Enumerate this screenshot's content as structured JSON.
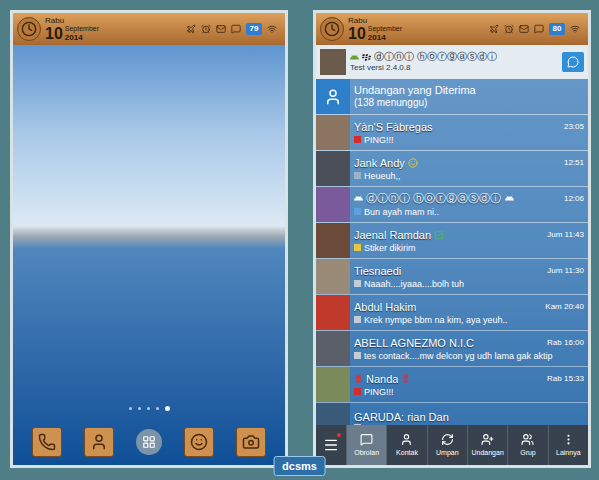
{
  "home_screen": {
    "status_bar": {
      "day": "Rabu",
      "date": "10",
      "month": "September",
      "year": "2014",
      "battery": "79"
    },
    "page_dots": [
      {
        "selected": false
      },
      {
        "selected": false
      },
      {
        "selected": false
      },
      {
        "selected": false
      },
      {
        "selected": true
      }
    ]
  },
  "bbm_screen": {
    "status_bar": {
      "day": "Rabu",
      "date": "10",
      "month": "September",
      "year": "2014",
      "battery": "80"
    },
    "profile": {
      "name": "ⓓⓘⓝⓘ ⓗⓞⓡⓖⓐⓢⓓⓘ",
      "status": "Test versi 2.4.0.8"
    },
    "chats": [
      {
        "kind": "invite",
        "name": "Undangan yang Diterima",
        "message": "(138 menunggu)"
      },
      {
        "kind": "chat",
        "name": "Yàn'S Fàbregas",
        "time": "23:05",
        "message": "PING!!!",
        "marker_color": "#d62b2b",
        "avatar_color": "#8c7560",
        "decorated": false,
        "smiley": false,
        "verified": false,
        "roses": false
      },
      {
        "kind": "chat",
        "name": "Jank Andy",
        "time": "12:51",
        "message": "Heueuh,,",
        "marker_color": "#9bb4c9",
        "avatar_color": "#4a4f5a",
        "decorated": false,
        "smiley": true,
        "verified": false,
        "roses": false
      },
      {
        "kind": "chat",
        "name": "ⓓⓘⓝⓘ ⓗⓞⓡⓖⓐⓢⓓⓘ",
        "time": "12:06",
        "message": "Bun ayah mam ni..",
        "marker_color": "#5e9fe0",
        "avatar_color": "#7a5a9a",
        "decorated": true,
        "smiley": false,
        "verified": false,
        "roses": false
      },
      {
        "kind": "chat",
        "name": "Jaenal Ramdan",
        "time": "Jum 11:43",
        "message": "Stiker dikirim",
        "marker_color": "#e8c640",
        "avatar_color": "#6b4a3a",
        "decorated": false,
        "smiley": false,
        "verified": true,
        "roses": false
      },
      {
        "kind": "chat",
        "name": "Tiesnaedi",
        "time": "Jum 11:30",
        "message": "Naaah....iyaaa....bolh tuh",
        "marker_color": "#c3ccd4",
        "avatar_color": "#9a8a78",
        "decorated": false,
        "smiley": false,
        "verified": false,
        "roses": false
      },
      {
        "kind": "chat",
        "name": "Abdul Hakim",
        "time": "Kam 20:40",
        "message": "Krek nympe bbm na kim, aya yeuh..",
        "marker_color": "#c3ccd4",
        "avatar_color": "#c0392b",
        "decorated": false,
        "smiley": false,
        "verified": false,
        "roses": false
      },
      {
        "kind": "chat",
        "name": "ABELL AGNEZMO N.I.C",
        "time": "Rab 16:00",
        "message": "tes contack....mw delcon yg udh lama gak aktip",
        "marker_color": "#c3ccd4",
        "avatar_color": "#5a5f6a",
        "decorated": false,
        "smiley": false,
        "verified": false,
        "roses": false
      },
      {
        "kind": "chat",
        "name": "Nanda",
        "time": "Rab 15:33",
        "message": "PING!!!",
        "marker_color": "#d62b2b",
        "avatar_color": "#7a8a5a",
        "decorated": false,
        "smiley": false,
        "verified": false,
        "roses": true
      },
      {
        "kind": "chat",
        "name": "GARUDA: rian Dan",
        "time": "",
        "message": "",
        "marker_color": "#c3ccd4",
        "avatar_color": "#3a5a7a",
        "decorated": false,
        "smiley": false,
        "verified": false,
        "roses": false
      }
    ],
    "nav": [
      {
        "label": "Obrolan",
        "selected": true
      },
      {
        "label": "Kontak",
        "selected": false
      },
      {
        "label": "Umpan",
        "selected": false
      },
      {
        "label": "Undangan",
        "selected": false
      },
      {
        "label": "Grup",
        "selected": false
      },
      {
        "label": "Lainnya",
        "selected": false
      }
    ]
  },
  "watermark": "dcsms"
}
